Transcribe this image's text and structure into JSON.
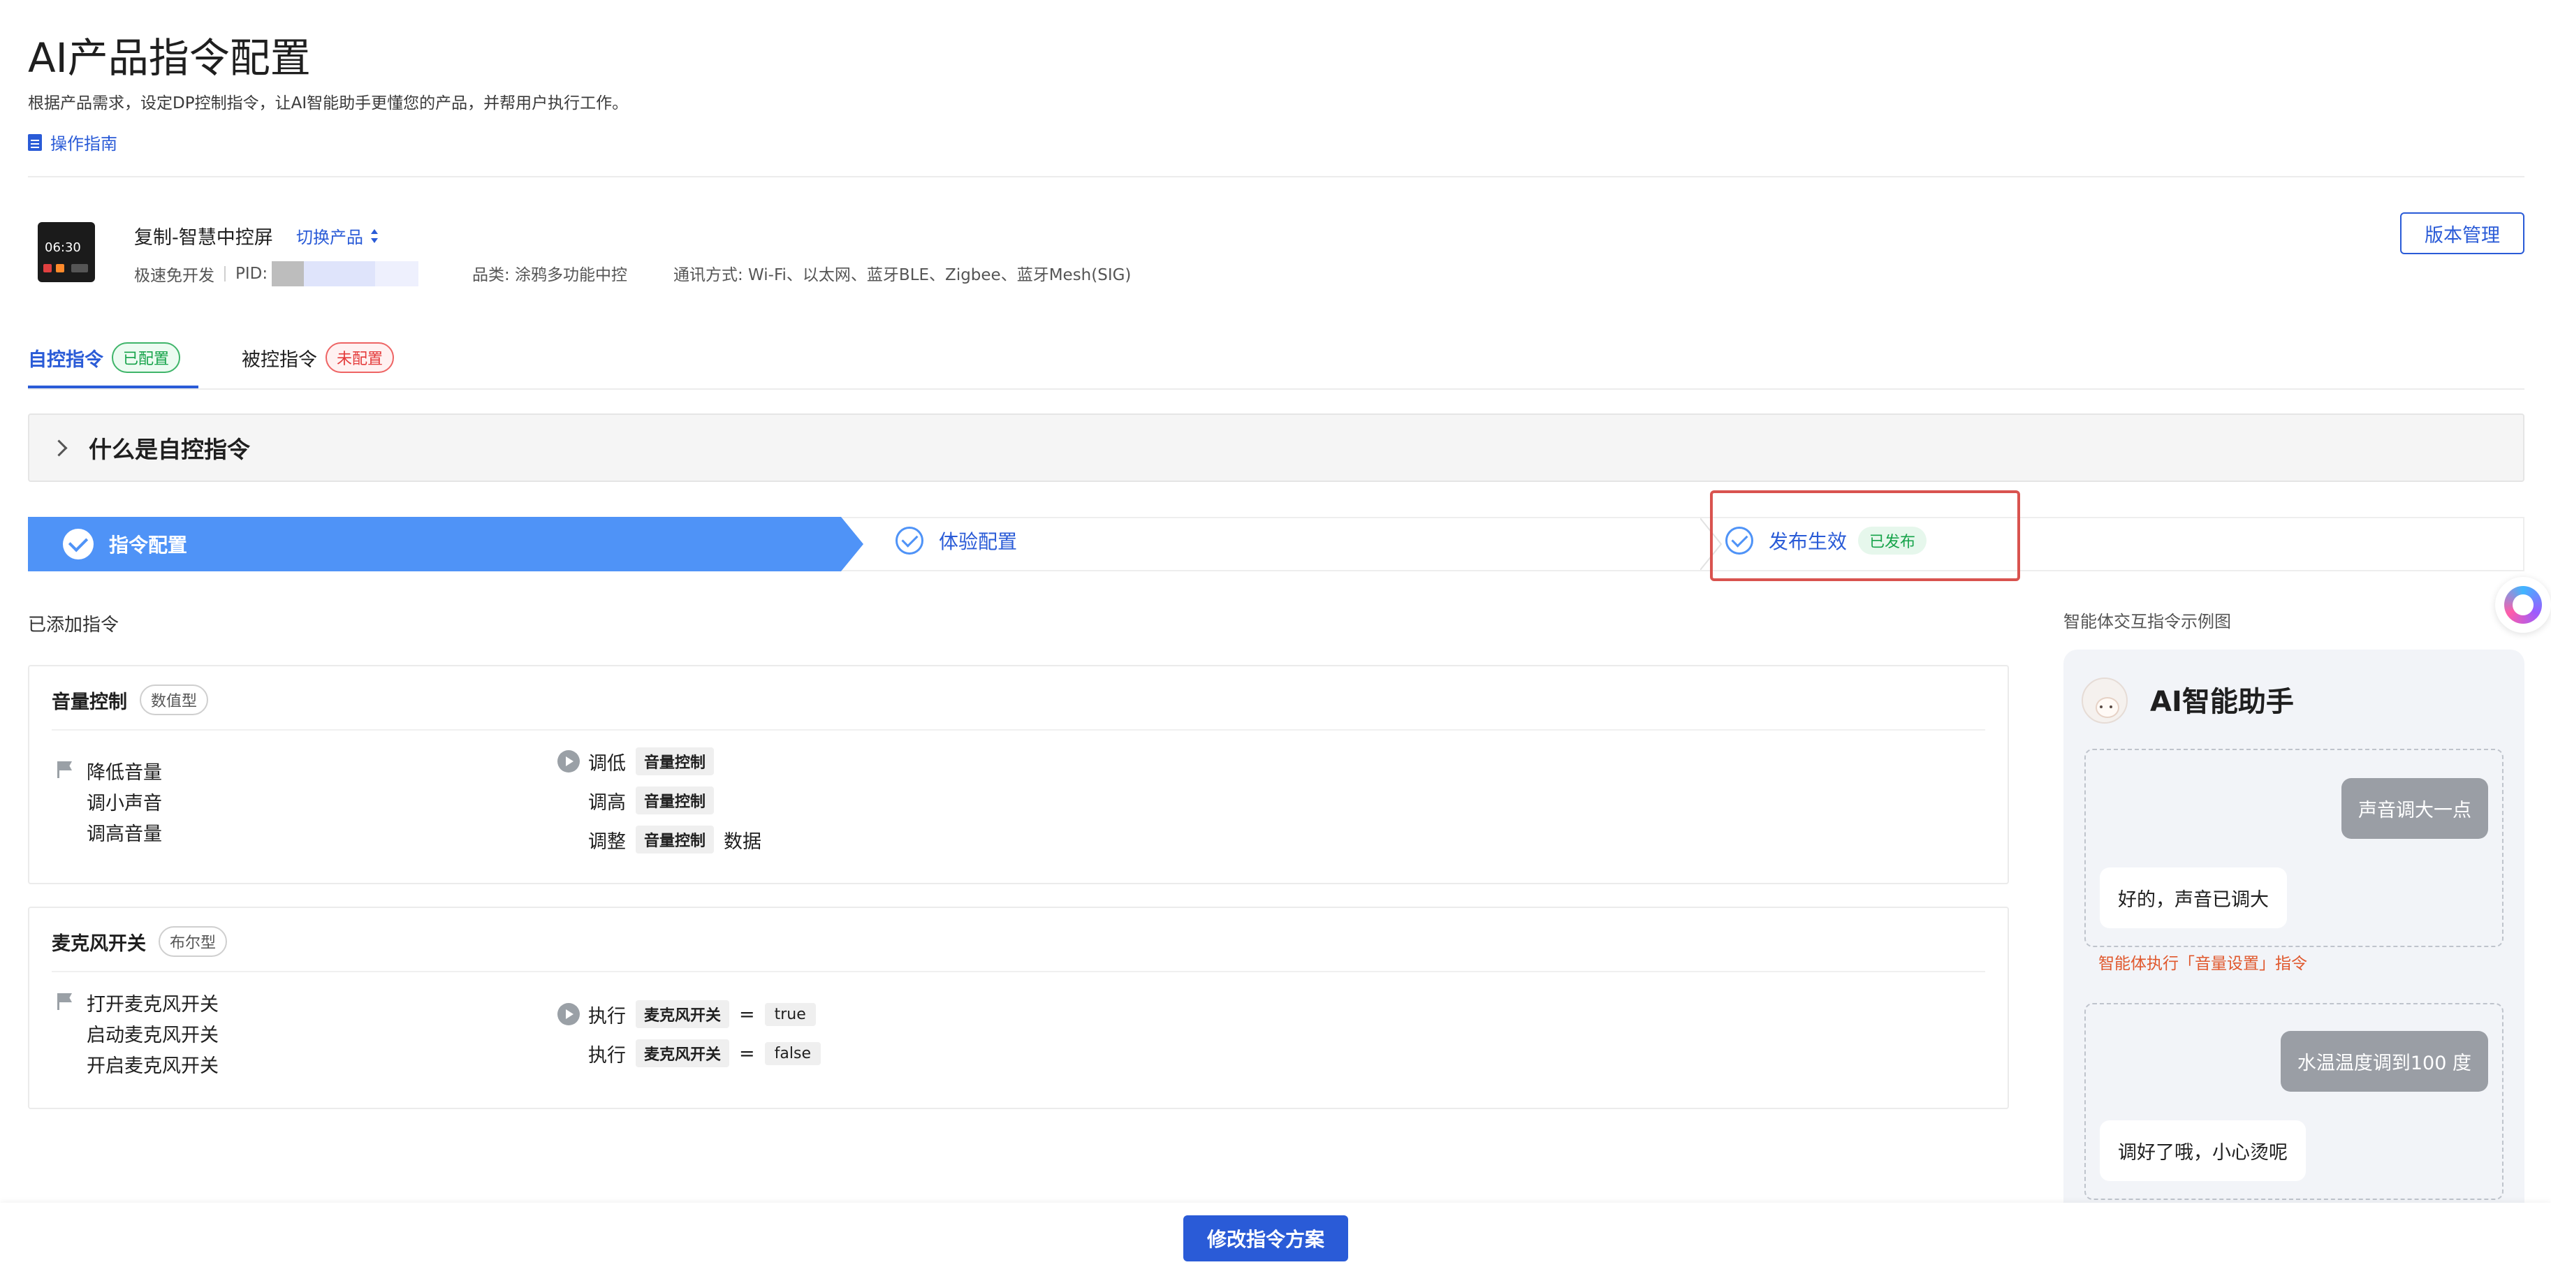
{
  "page": {
    "title": "AI产品指令配置",
    "description": "根据产品需求，设定DP控制指令，让AI智能助手更懂您的产品，并帮用户执行工作。",
    "guide_link": "操作指南"
  },
  "product": {
    "name": "复制-智慧中控屏",
    "switch_label": "切换产品",
    "thumb_time": "06:30",
    "dev_mode": "极速免开发",
    "pid_label": "PID:",
    "category": "品类: 涂鸦多功能中控",
    "communication": "通讯方式: Wi-Fi、以太网、蓝牙BLE、Zigbee、蓝牙Mesh(SIG)",
    "version_button": "版本管理"
  },
  "tabs": [
    {
      "label": "自控指令",
      "badge": "已配置",
      "active": true
    },
    {
      "label": "被控指令",
      "badge": "未配置",
      "active": false
    }
  ],
  "collapse": {
    "label": "什么是自控指令"
  },
  "steps": [
    {
      "label": "指令配置",
      "state": "done"
    },
    {
      "label": "体验配置",
      "state": "done"
    },
    {
      "label": "发布生效",
      "badge": "已发布",
      "state": "done"
    }
  ],
  "commands": {
    "section_title": "已添加指令",
    "items": [
      {
        "title": "音量控制",
        "type": "数值型",
        "phrases": [
          "降低音量",
          "调小声音",
          "调高音量"
        ],
        "actions": [
          {
            "verb": "调低",
            "dp": "音量控制"
          },
          {
            "verb": "调高",
            "dp": "音量控制"
          },
          {
            "verb": "调整",
            "dp": "音量控制",
            "suffix": "数据"
          }
        ]
      },
      {
        "title": "麦克风开关",
        "type": "布尔型",
        "phrases": [
          "打开麦克风开关",
          "启动麦克风开关",
          "开启麦克风开关"
        ],
        "actions": [
          {
            "verb": "执行",
            "dp": "麦克风开关",
            "eq": "=",
            "value": "true"
          },
          {
            "verb": "执行",
            "dp": "麦克风开关",
            "eq": "=",
            "value": "false"
          }
        ]
      }
    ]
  },
  "example": {
    "title": "智能体交互指令示例图",
    "assistant_name": "AI智能助手",
    "dialogs": [
      {
        "user": "声音调大一点",
        "bot": "好的，声音已调大"
      },
      {
        "user": "水温温度调到100 度",
        "bot": "调好了哦，小心烫呢"
      }
    ],
    "exec_note": "智能体执行「音量设置」指令"
  },
  "footer": {
    "modify_button": "修改指令方案"
  },
  "colors": {
    "primary": "#2a5bd7",
    "step_fill": "#4f93f7",
    "success": "#16a34a",
    "danger": "#e43b3b",
    "highlight": "#d9534f"
  }
}
